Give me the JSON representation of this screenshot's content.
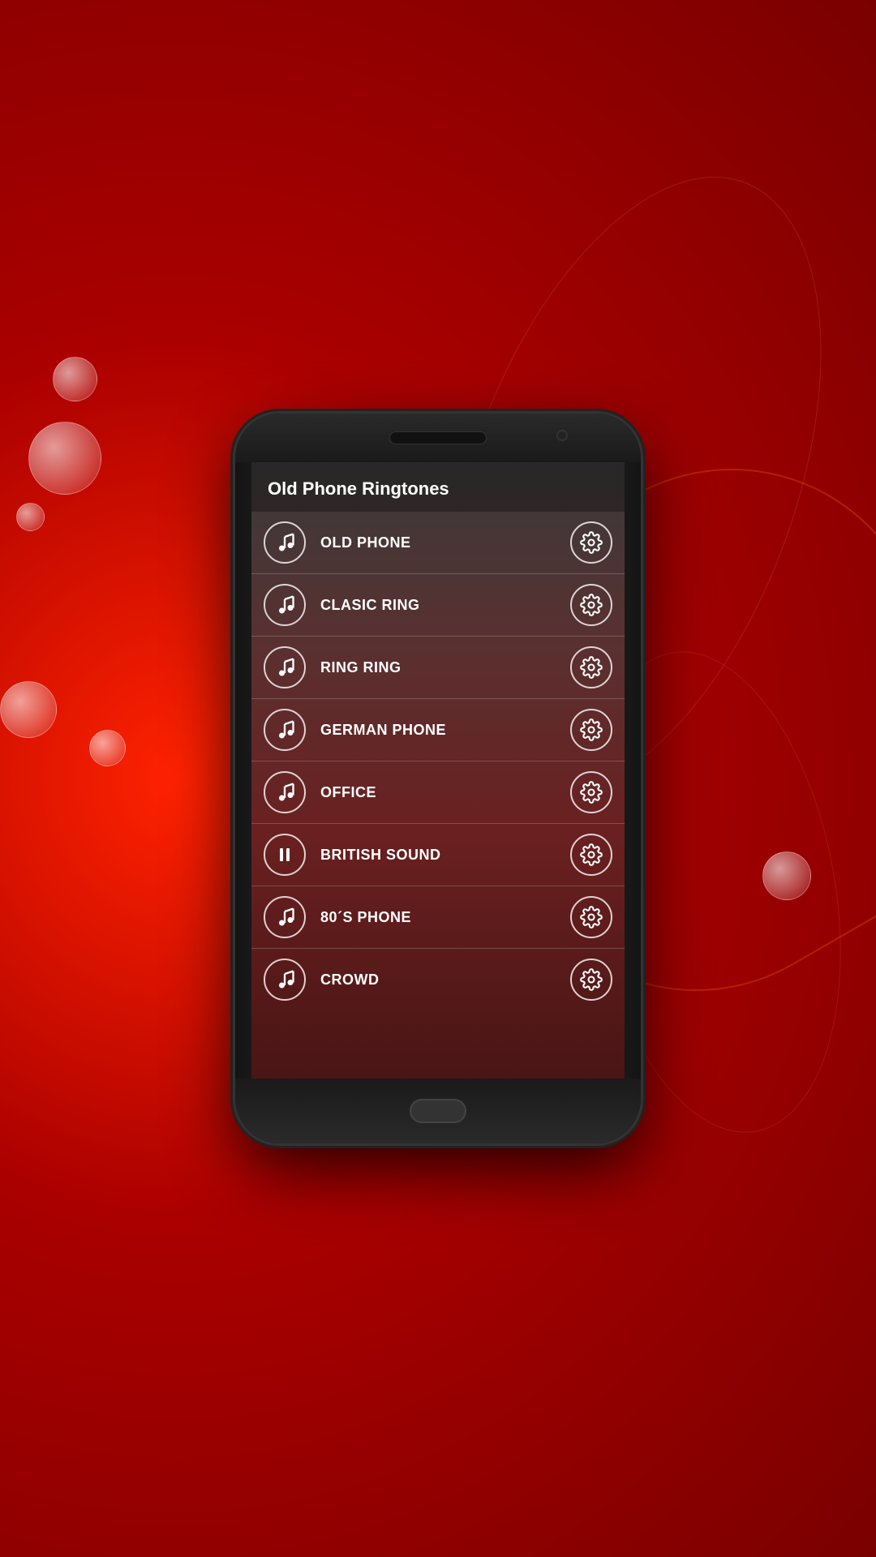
{
  "app": {
    "title": "Old Phone Ringtones"
  },
  "ringtones": [
    {
      "id": "old-phone",
      "name": "OLD PHONE",
      "playing": false
    },
    {
      "id": "clasic-ring",
      "name": "CLASIC RING",
      "playing": false
    },
    {
      "id": "ring-ring",
      "name": "RING RING",
      "playing": false
    },
    {
      "id": "german-phone",
      "name": "GERMAN PHONE",
      "playing": false
    },
    {
      "id": "office",
      "name": "OFFICE",
      "playing": false
    },
    {
      "id": "british-sound",
      "name": "BRITISH SOUND",
      "playing": true
    },
    {
      "id": "80s-phone",
      "name": "80´S PHONE",
      "playing": false
    },
    {
      "id": "crowd",
      "name": "CROWD",
      "playing": false
    }
  ],
  "icons": {
    "music_note": "music-note-icon",
    "pause": "pause-icon",
    "settings": "gear-icon"
  },
  "colors": {
    "background_red": "#c0000a",
    "screen_bg_top": "#3a3a3a",
    "screen_bg_bottom": "#4a1515",
    "text_white": "#ffffff",
    "icon_border": "rgba(255,255,255,0.8)"
  }
}
